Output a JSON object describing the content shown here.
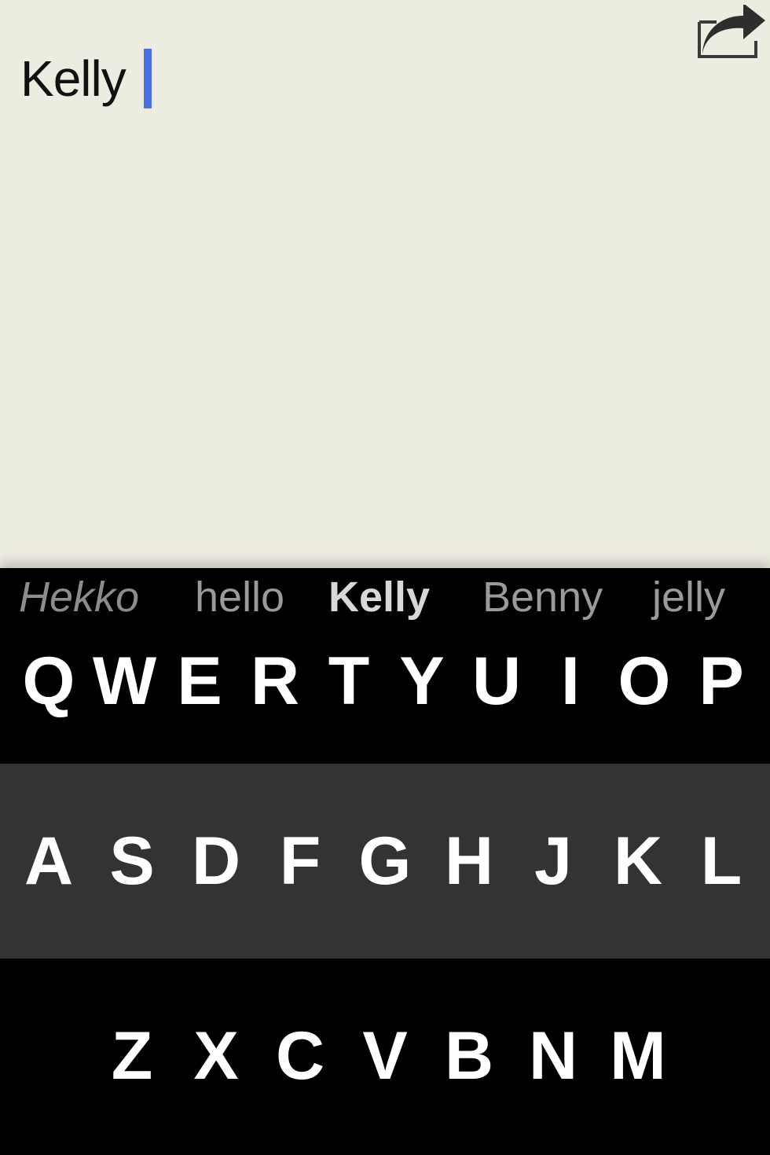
{
  "editor": {
    "text": "Kelly"
  },
  "share": {
    "icon": "share-icon"
  },
  "suggestions": [
    "Hekko",
    "hello",
    "Kelly",
    "Benny",
    "jelly"
  ],
  "selected_suggestion": "Kelly",
  "keyboard": {
    "row1": [
      "Q",
      "W",
      "E",
      "R",
      "T",
      "Y",
      "U",
      "I",
      "O",
      "P"
    ],
    "row2": [
      "A",
      "S",
      "D",
      "F",
      "G",
      "H",
      "J",
      "K",
      "L"
    ],
    "row3": [
      "Z",
      "X",
      "C",
      "V",
      "B",
      "N",
      "M"
    ]
  },
  "colors": {
    "caret": "#4a6fe0",
    "editor_bg": "#edece1",
    "keyboard_bg": "#000000",
    "middle_row_bg": "#333333"
  }
}
